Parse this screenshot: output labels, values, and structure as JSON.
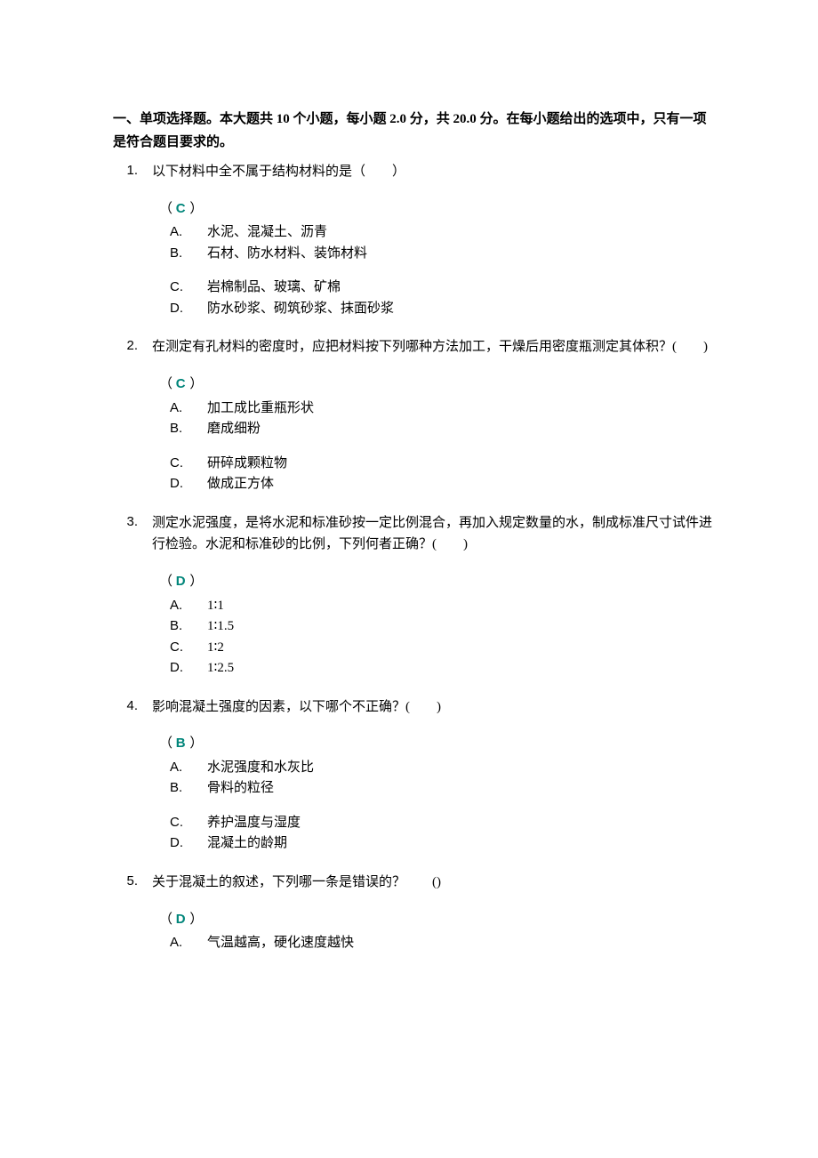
{
  "heading": {
    "prefix": "一、单项选择题。本大题共 ",
    "count": "10",
    "mid1": " 个小题，每小题 ",
    "per": "2.0",
    "mid2": " 分，共 ",
    "total": "20.0",
    "suffix": " 分。在每小题给出的选项中，只有一项是符合题目要求的。"
  },
  "questions": [
    {
      "num": "1.",
      "text": "以下材料中全不属于结构材料的是（　　）",
      "answer": "C",
      "groups": [
        [
          {
            "label": "A.",
            "text": "水泥、混凝土、沥青"
          },
          {
            "label": "B.",
            "text": "石材、防水材料、装饰材料"
          }
        ],
        [
          {
            "label": "C.",
            "text": "岩棉制品、玻璃、矿棉"
          },
          {
            "label": "D.",
            "text": "防水砂浆、砌筑砂浆、抹面砂浆"
          }
        ]
      ]
    },
    {
      "num": "2.",
      "text": "在测定有孔材料的密度时，应把材料按下列哪种方法加工，干燥后用密度瓶测定其体积？(　　)",
      "answer": "C",
      "groups": [
        [
          {
            "label": "A.",
            "text": "加工成比重瓶形状"
          },
          {
            "label": "B.",
            "text": "磨成细粉"
          }
        ],
        [
          {
            "label": "C.",
            "text": "研碎成颗粒物"
          },
          {
            "label": "D.",
            "text": "做成正方体"
          }
        ]
      ]
    },
    {
      "num": "3.",
      "text": "测定水泥强度，是将水泥和标准砂按一定比例混合，再加入规定数量的水，制成标准尺寸试件进行检验。水泥和标准砂的比例，下列何者正确？(　　)",
      "answer": "D",
      "groups": [
        [
          {
            "label": "A.",
            "text": "1∶1"
          },
          {
            "label": "B.",
            "text": "1∶1.5"
          },
          {
            "label": "C.",
            "text": "1∶2"
          },
          {
            "label": "D.",
            "text": "1∶2.5"
          }
        ]
      ]
    },
    {
      "num": "4.",
      "text": "影响混凝土强度的因素，以下哪个不正确？(　　)",
      "answer": "B",
      "groups": [
        [
          {
            "label": "A.",
            "text": "水泥强度和水灰比"
          },
          {
            "label": "B.",
            "text": "骨料的粒径"
          }
        ],
        [
          {
            "label": "C.",
            "text": "养护温度与湿度"
          },
          {
            "label": "D.",
            "text": "混凝土的龄期"
          }
        ]
      ]
    },
    {
      "num": "5.",
      "text": "关于混凝土的叙述，下列哪一条是错误的？　　()",
      "answer": "D",
      "groups": [
        [
          {
            "label": "A.",
            "text": "气温越高，硬化速度越快"
          }
        ]
      ]
    }
  ]
}
